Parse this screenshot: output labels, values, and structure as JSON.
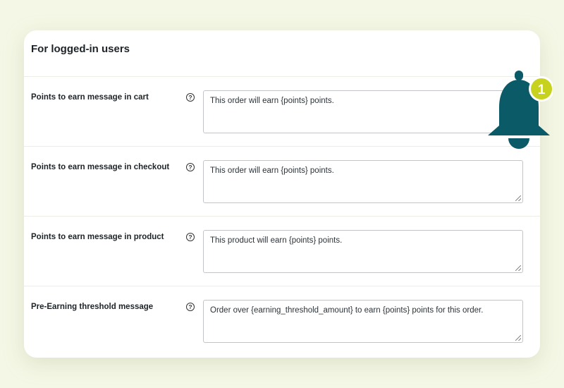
{
  "section": {
    "title": "For logged-in users"
  },
  "rows": [
    {
      "label": "Points to earn message in cart",
      "value": "This order will earn {points} points."
    },
    {
      "label": "Points to earn message in checkout",
      "value": "This order will earn {points} points."
    },
    {
      "label": "Points to earn message in product",
      "value": "This product will earn {points} points."
    },
    {
      "label": "Pre-Earning threshold message",
      "value": "Order over {earning_threshold_amount} to earn {points} points for this order."
    }
  ],
  "help_glyph": "?",
  "notification": {
    "count": "1",
    "icon": "bell-icon",
    "bell_color": "#0a5a67",
    "badge_color": "#c6d21e"
  },
  "colors": {
    "background": "#f5f7e6",
    "card": "#ffffff"
  }
}
